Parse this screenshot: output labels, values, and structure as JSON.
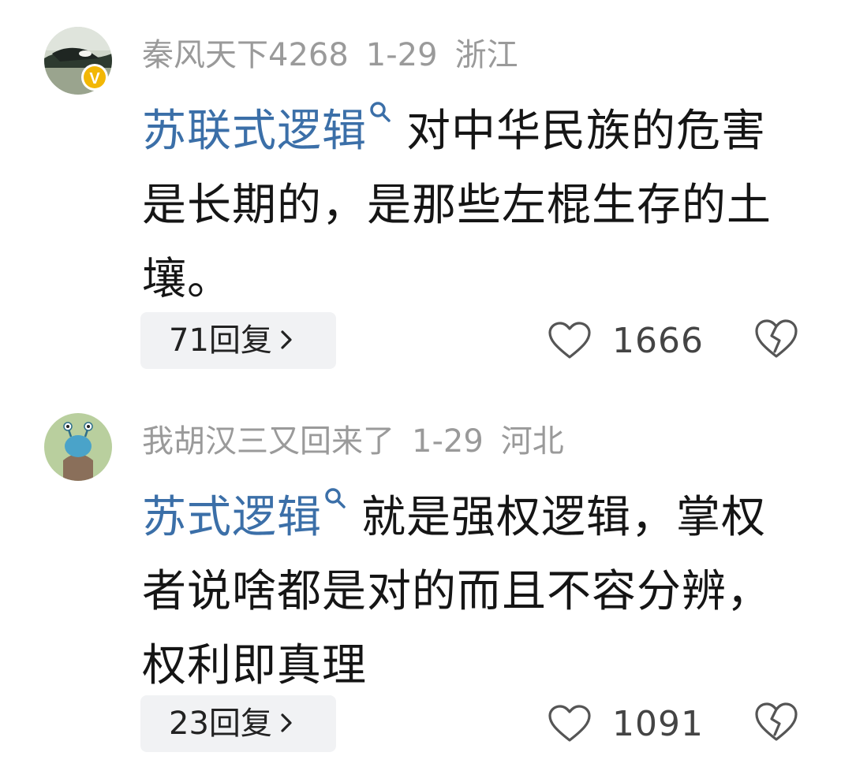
{
  "comments": [
    {
      "username": "秦风天下4268",
      "date": "1-29",
      "location": "浙江",
      "verified_badge": "V",
      "topic": "苏联式逻辑",
      "text": "对中华民族的危害是长期的，是那些左棍生存的土壤。",
      "replies_label": "71回复",
      "likes": "1666",
      "icons": [
        "avatar",
        "search-icon",
        "chevron-right-icon",
        "heart-icon",
        "broken-heart-icon"
      ]
    },
    {
      "username": "我胡汉三又回来了",
      "date": "1-29",
      "location": "河北",
      "topic": "苏式逻辑",
      "text": "就是强权逻辑，掌权者说啥都是对的而且不容分辨，权利即真理",
      "replies_label": "23回复",
      "likes": "1091",
      "icons": [
        "avatar",
        "search-icon",
        "chevron-right-icon",
        "heart-icon",
        "broken-heart-icon"
      ]
    }
  ],
  "colors": {
    "topic_link": "#3b6fa8",
    "meta_text": "#9a9a9a",
    "reply_bg": "#f1f2f4",
    "verified_badge": "#f2b705"
  }
}
